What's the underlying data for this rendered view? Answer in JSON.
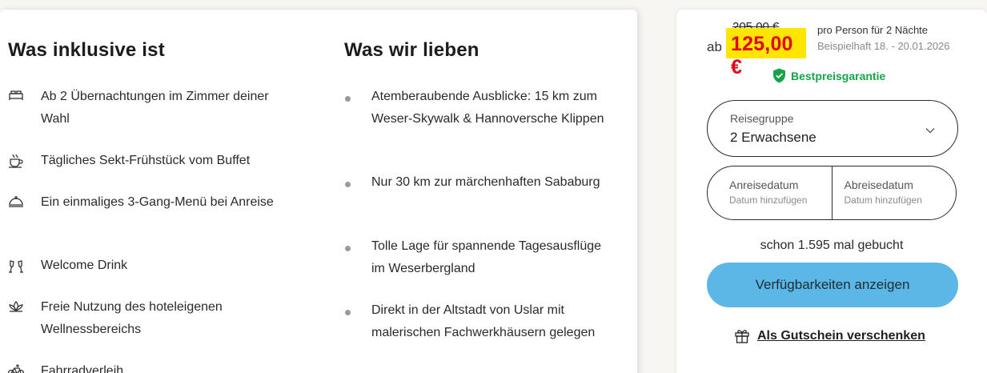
{
  "inclusions": {
    "title": "Was inklusive ist",
    "items": [
      {
        "icon": "bed-icon",
        "text": "Ab 2 Übernachtungen im Zimmer deiner Wahl"
      },
      {
        "icon": "coffee-cup-icon",
        "text": "Tägliches Sekt-Frühstück vom Buffet"
      },
      {
        "icon": "cloche-icon",
        "text": "Ein einmaliges 3-Gang-Menü bei Anreise"
      },
      {
        "icon": "champagne-glasses-icon",
        "text": "Welcome Drink"
      },
      {
        "icon": "lotus-icon",
        "text": "Freie Nutzung des hoteleigenen Wellnessbereichs"
      },
      {
        "icon": "bicycle-icon",
        "text": "Fahrradverleih"
      }
    ]
  },
  "highlights": {
    "title": "Was wir lieben",
    "items": [
      {
        "text": "Atemberaubende Ausblicke: 15 km zum Weser-Skywalk & Hannoversche Klippen"
      },
      {
        "text": "Nur 30 km zur märchenhaften Sababurg"
      },
      {
        "text": "Tolle Lage für spannende Tagesausflüge im Weserbergland"
      },
      {
        "text": "Direkt in der Altstadt von Uslar mit malerischen Fachwerkhäusern gelegen"
      }
    ]
  },
  "booking": {
    "old_price": "205,00 €",
    "ab_label": "ab",
    "new_price": "125,00 €",
    "price_note": "pro Person für 2 Nächte",
    "example_dates": "Beispielhaft 18. - 20.01.2026",
    "guarantee": "Bestpreisgarantie",
    "travel_group": {
      "label": "Reisegruppe",
      "value": "2 Erwachsene"
    },
    "arrival": {
      "label": "Anreisedatum",
      "placeholder": "Datum hinzufügen"
    },
    "departure": {
      "label": "Abreisedatum",
      "placeholder": "Datum hinzufügen"
    },
    "booked_count": "schon 1.595 mal gebucht",
    "cta_label": "Verfügbarkeiten anzeigen",
    "voucher_label": "Als Gutschein verschenken",
    "colors": {
      "price_highlight": "#ffe600",
      "price_text": "#e3001b",
      "cta": "#5bb8e6",
      "guarantee": "#16a34a"
    }
  }
}
